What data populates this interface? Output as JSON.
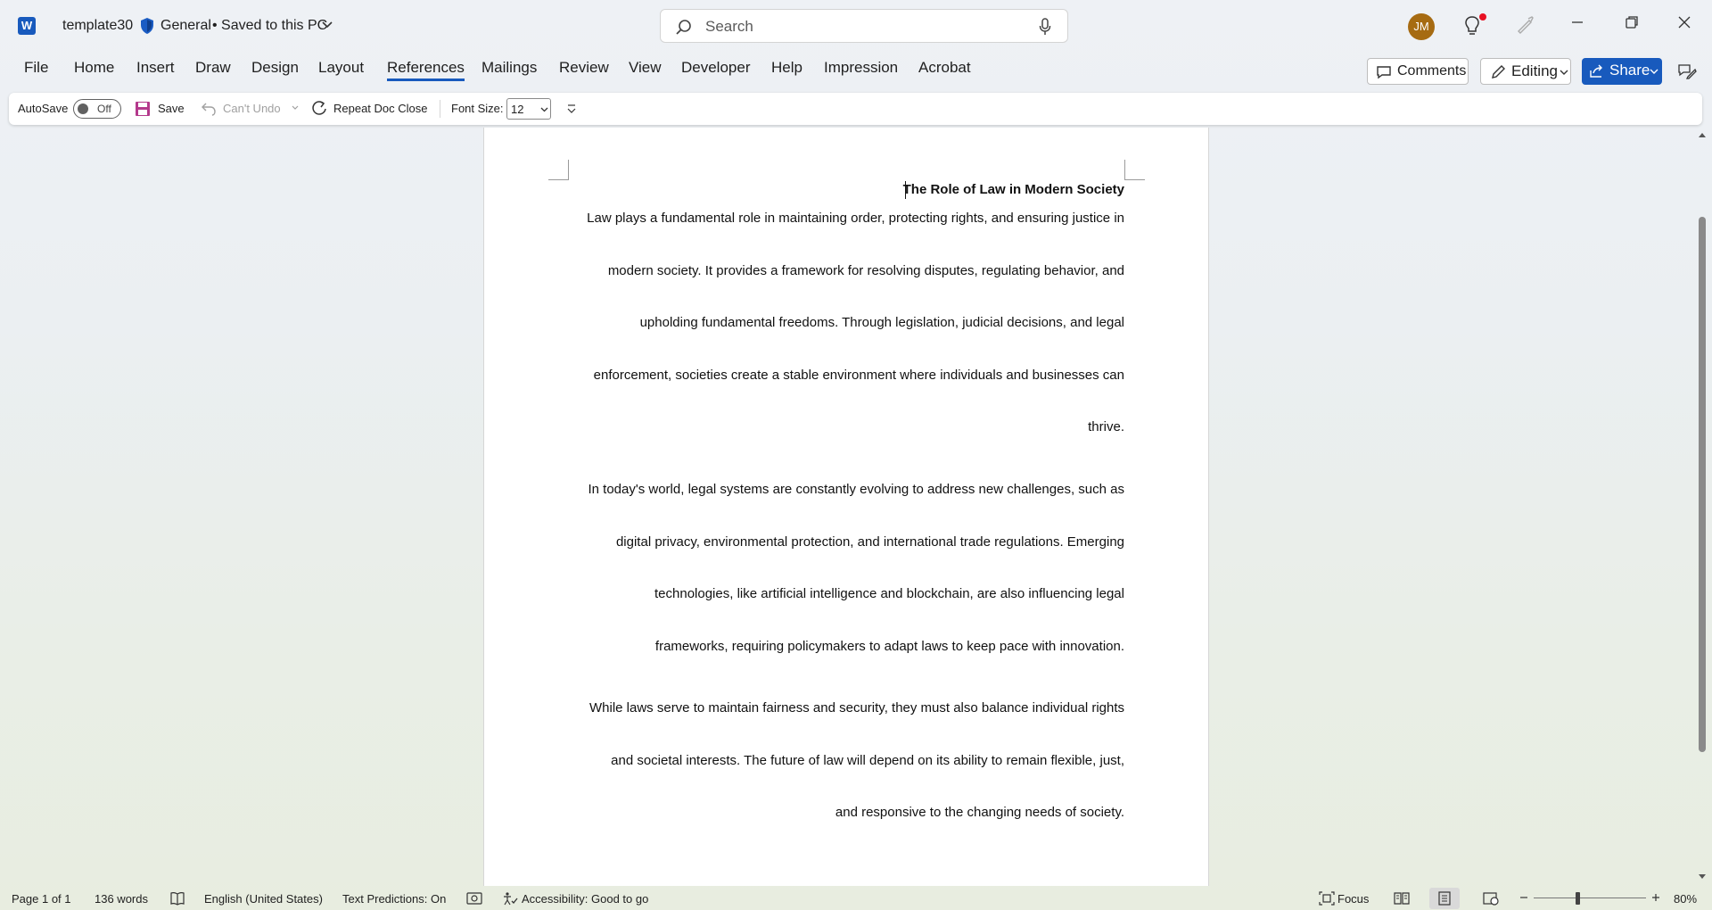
{
  "titlebar": {
    "app_icon": "W",
    "doc_name": "template30",
    "sensitivity": "General",
    "save_status": "• Saved to this PC",
    "search_placeholder": "Search",
    "avatar_initials": "JM"
  },
  "menu": {
    "items": [
      "File",
      "Home",
      "Insert",
      "Draw",
      "Design",
      "Layout",
      "References",
      "Mailings",
      "Review",
      "View",
      "Developer",
      "Help",
      "Impression",
      "Acrobat"
    ],
    "active": "References",
    "comments_label": "Comments",
    "editing_label": "Editing",
    "share_label": "Share"
  },
  "toolbar": {
    "autosave_label": "AutoSave",
    "autosave_state": "Off",
    "save_label": "Save",
    "undo_label": "Can't Undo",
    "repeat_label": "Repeat Doc Close",
    "font_size_label": "Font Size:",
    "font_size_value": "12"
  },
  "document": {
    "heading": "The Role of Law in Modern Society",
    "lines": [
      "Law plays a fundamental role in maintaining order, protecting rights, and ensuring justice in",
      "modern society. It provides a framework for resolving disputes, regulating behavior, and",
      "upholding fundamental freedoms. Through legislation, judicial decisions, and legal",
      "enforcement, societies create a stable environment where individuals and businesses can",
      "thrive.",
      "In today's world, legal systems are constantly evolving to address new challenges, such as",
      "digital privacy, environmental protection, and international trade regulations. Emerging",
      "technologies, like artificial intelligence and blockchain, are also influencing legal",
      "frameworks, requiring policymakers to adapt laws to keep pace with innovation.",
      "While laws serve to maintain fairness and security, they must also balance individual rights",
      "and societal interests. The future of law will depend on its ability to remain flexible, just,",
      "and responsive to the changing needs of society."
    ]
  },
  "status": {
    "page": "Page 1 of 1",
    "words": "136 words",
    "language": "English (United States)",
    "predictions": "Text Predictions: On",
    "accessibility": "Accessibility: Good to go",
    "focus": "Focus",
    "zoom": "80%"
  },
  "colors": {
    "accent": "#185abd",
    "avatar": "#a66b12",
    "notification": "#e81123"
  }
}
